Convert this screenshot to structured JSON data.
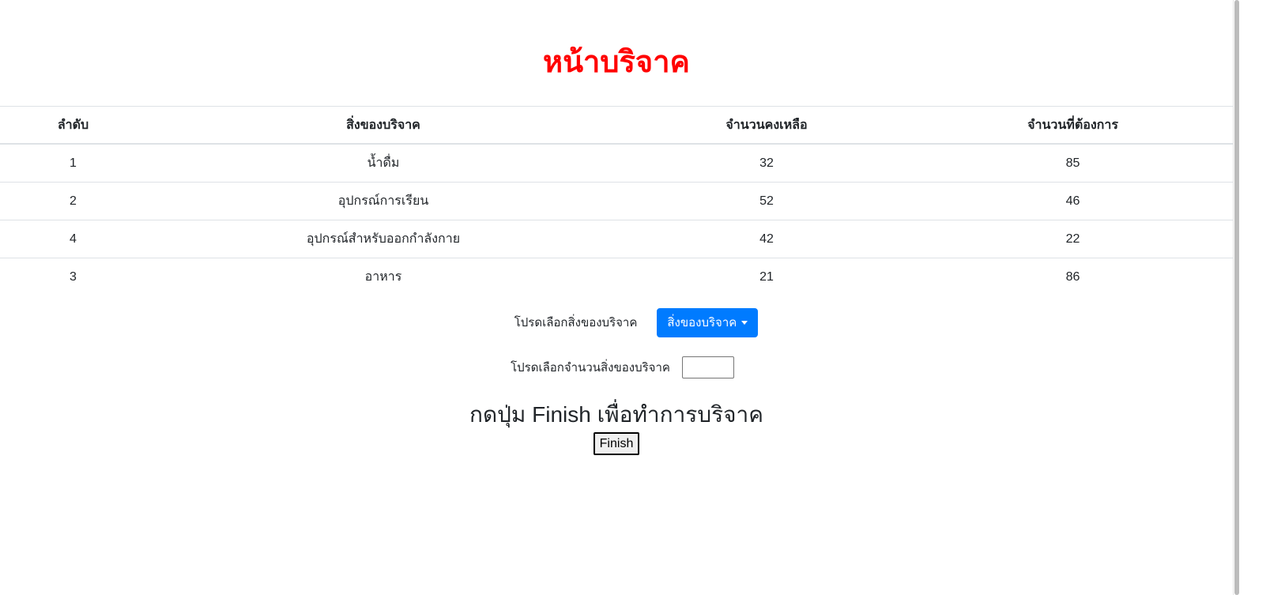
{
  "page": {
    "title": "หน้าบริจาค"
  },
  "table": {
    "headers": [
      "ลำดับ",
      "สิ่งของบริจาค",
      "จำนวนคงเหลือ",
      "จำนวนที่ต้องการ"
    ],
    "rows": [
      {
        "order": "1",
        "item": "น้ำดื่ม",
        "remaining": "32",
        "needed": "85"
      },
      {
        "order": "2",
        "item": "อุปกรณ์การเรียน",
        "remaining": "52",
        "needed": "46"
      },
      {
        "order": "4",
        "item": "อุปกรณ์สำหรับออกกำลังกาย",
        "remaining": "42",
        "needed": "22"
      },
      {
        "order": "3",
        "item": "อาหาร",
        "remaining": "21",
        "needed": "86"
      }
    ]
  },
  "form": {
    "select_item_label": "โปรดเลือกสิ่งของบริจาค",
    "dropdown_label": "สิ่งของบริจาค",
    "quantity_label": "โปรดเลือกจำนวนสิ่งของบริจาค",
    "quantity_value": "",
    "finish_heading": "กดปุ่ม Finish เพื่อทำการบริจาค",
    "finish_label": "Finish"
  },
  "colors": {
    "title": "#ff0000",
    "dropdown_bg": "#007bff",
    "table_border": "#dee2e6"
  }
}
